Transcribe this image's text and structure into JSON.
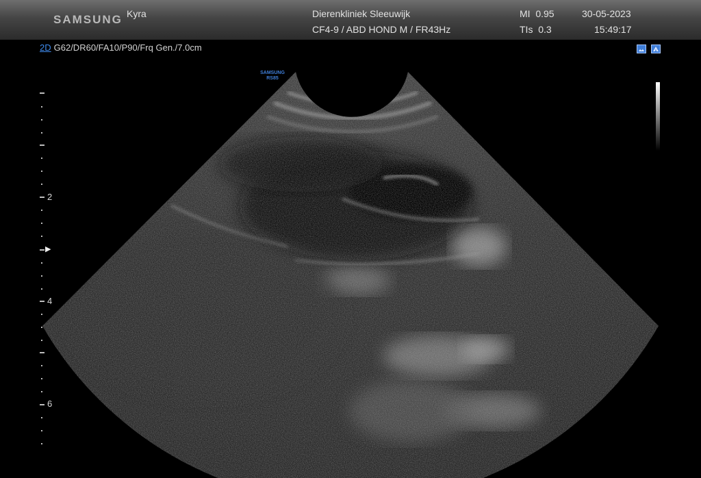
{
  "header": {
    "brand": "SAMSUNG",
    "patient": "Kyra",
    "clinic": "Dierenkliniek Sleeuwijk",
    "probe_preset": "CF4-9 / ABD HOND M / FR43Hz",
    "mi": "MI  0.95",
    "tis": "TIs  0.3",
    "date": "30-05-2023",
    "time": "15:49:17"
  },
  "params": {
    "mode": "2D",
    "settings": "G62/DR60/FA10/P90/Frq Gen./7.0cm"
  },
  "probe_label": {
    "line1": "SAMSUNG",
    "line2": "RS85"
  },
  "depth_scale": {
    "labels": [
      "2",
      "4",
      "6"
    ],
    "focus_marker": "▶"
  },
  "icons": [
    "mode-icon-a",
    "mode-icon-b"
  ]
}
